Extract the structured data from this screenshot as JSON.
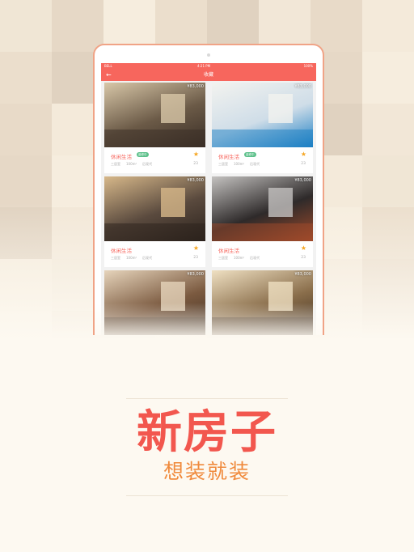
{
  "status_bar": {
    "carrier": "BELL",
    "time": "4:21 PM",
    "battery": "100%"
  },
  "nav": {
    "title": "收藏"
  },
  "listings": [
    {
      "title": "休闲生活",
      "tag": "装修中",
      "layout": "三居室",
      "area": "100m²",
      "style": "后现代",
      "price": "¥83,000",
      "count": "23",
      "palette": [
        "#6b5a47",
        "#d8c7a8",
        "#3a2e26"
      ]
    },
    {
      "title": "休闲生活",
      "tag": "装修中",
      "layout": "三居室",
      "area": "100m²",
      "style": "后现代",
      "price": "¥83,000",
      "count": "23",
      "palette": [
        "#cfdde8",
        "#f3f3ef",
        "#1c7fc4"
      ]
    },
    {
      "title": "休闲生活",
      "tag": "",
      "layout": "三居室",
      "area": "100m²",
      "style": "后现代",
      "price": "¥83,000",
      "count": "23",
      "palette": [
        "#5a4a3e",
        "#d7b88a",
        "#2b221c"
      ]
    },
    {
      "title": "休闲生活",
      "tag": "",
      "layout": "三居室",
      "area": "100m²",
      "style": "后现代",
      "price": "¥83,000",
      "count": "23",
      "palette": [
        "#2e2a2a",
        "#c4c2c0",
        "#a04a2a"
      ]
    },
    {
      "title": "",
      "tag": "",
      "layout": "",
      "area": "",
      "style": "",
      "price": "¥83,000",
      "count": "",
      "palette": [
        "#7b5a40",
        "#e6d4bb",
        "#3f2d20"
      ]
    },
    {
      "title": "",
      "tag": "",
      "layout": "",
      "area": "",
      "style": "",
      "price": "¥83,000",
      "count": "",
      "palette": [
        "#8a6e4b",
        "#efe0c2",
        "#3b2a1c"
      ]
    }
  ],
  "tagline": {
    "headline": "新房子",
    "subline": "想装就装"
  },
  "colors": {
    "accent": "#f7665d",
    "headline": "#f2574e",
    "subline": "#f08a3c",
    "star": "#f5a623",
    "tag": "#5cc08a"
  }
}
